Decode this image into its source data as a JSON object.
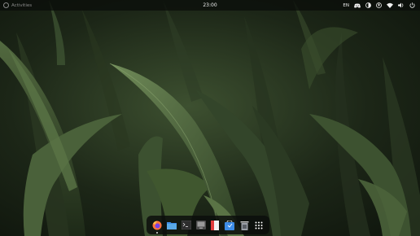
{
  "topbar": {
    "activities_label": "Activities",
    "clock": "23:00",
    "tray": {
      "language": "EN",
      "icons": [
        "discord-icon",
        "night-light-icon",
        "accessibility-icon",
        "wifi-icon",
        "volume-icon",
        "power-icon"
      ]
    }
  },
  "dock": {
    "apps": [
      {
        "name": "firefox",
        "icon": "firefox-icon",
        "color": "#ff7139",
        "running": true
      },
      {
        "name": "files",
        "icon": "folder-icon",
        "color": "#5aa9e6",
        "running": false
      },
      {
        "name": "terminal",
        "icon": "terminal-icon",
        "color": "#2d2d2d",
        "running": false
      },
      {
        "name": "screenshot",
        "icon": "screenshot-icon",
        "color": "#9a9a9a",
        "running": false
      },
      {
        "name": "document-viewer",
        "icon": "document-icon",
        "color": "#e03c3c",
        "running": false
      },
      {
        "name": "software",
        "icon": "software-store-icon",
        "color": "#3d8ce6",
        "running": false
      },
      {
        "name": "trash",
        "icon": "trash-icon",
        "color": "#c8c8c8",
        "running": false
      },
      {
        "name": "app-grid",
        "icon": "app-grid-icon",
        "color": "#ffffff",
        "running": false
      }
    ]
  },
  "colors": {
    "topbar_bg": "#0a0c0a",
    "wallpaper_dark": "#0e140c",
    "wallpaper_mid": "#3d5030"
  }
}
